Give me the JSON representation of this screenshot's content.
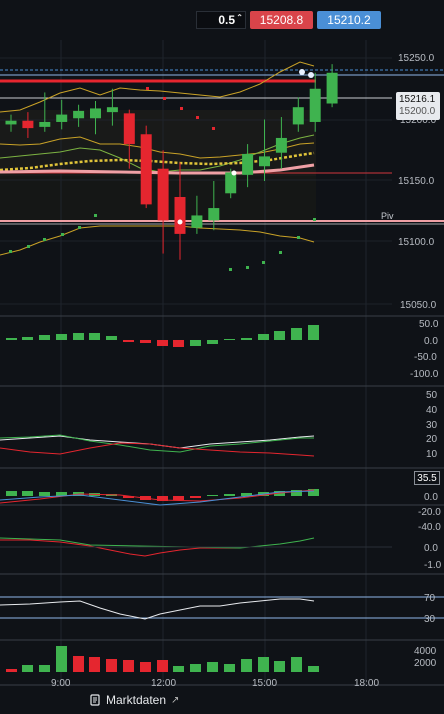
{
  "toolbar": {
    "quantity": "0.5",
    "sell_price": "15208.8",
    "buy_price": "15210.2"
  },
  "price_axis": {
    "ticks": [
      "15250.0",
      "15200.0",
      "15150.0",
      "15100.0",
      "15050.0"
    ],
    "last_price": "15216.1",
    "last_price_sub": "15200.0",
    "pivot_label": "Piv"
  },
  "time_axis": {
    "ticks": [
      "9:00",
      "12:00",
      "15:00",
      "18:00"
    ]
  },
  "panels": {
    "p1_ticks": [
      "50.0",
      "0.0",
      "-50.0",
      "-100.0"
    ],
    "p2_ticks": [
      "50",
      "40",
      "30",
      "20",
      "10"
    ],
    "p3_ticks": [
      "0.0",
      "-20.0",
      "-40.0"
    ],
    "p3_current": "35.5",
    "p4_ticks": [
      "0.0",
      "-1.0"
    ],
    "p5_ticks": [
      "70",
      "30"
    ],
    "p6_ticks": [
      "4000",
      "2000"
    ]
  },
  "footer": {
    "market_data_label": "Marktdaten"
  },
  "colors": {
    "up": "#3fb34f",
    "down": "#e5262f",
    "sell": "#d9444a",
    "buy": "#4a8fd6",
    "envelope": "#c9a227",
    "ma": "#e0c43a",
    "pivot": "#f0a0a5"
  },
  "chart_data": {
    "type": "candlestick",
    "ylim": [
      15035,
      15265
    ],
    "candles": [
      {
        "o": 15196,
        "h": 15204,
        "l": 15190,
        "c": 15199
      },
      {
        "o": 15199,
        "h": 15206,
        "l": 15185,
        "c": 15193
      },
      {
        "o": 15194,
        "h": 15222,
        "l": 15190,
        "c": 15198
      },
      {
        "o": 15198,
        "h": 15216,
        "l": 15192,
        "c": 15204
      },
      {
        "o": 15201,
        "h": 15212,
        "l": 15194,
        "c": 15207
      },
      {
        "o": 15201,
        "h": 15215,
        "l": 15188,
        "c": 15209
      },
      {
        "o": 15206,
        "h": 15225,
        "l": 15195,
        "c": 15210
      },
      {
        "o": 15205,
        "h": 15208,
        "l": 15160,
        "c": 15180
      },
      {
        "o": 15188,
        "h": 15195,
        "l": 15128,
        "c": 15131
      },
      {
        "o": 15160,
        "h": 15175,
        "l": 15091,
        "c": 15118
      },
      {
        "o": 15137,
        "h": 15165,
        "l": 15086,
        "c": 15107
      },
      {
        "o": 15112,
        "h": 15138,
        "l": 15107,
        "c": 15122
      },
      {
        "o": 15118,
        "h": 15150,
        "l": 15110,
        "c": 15128
      },
      {
        "o": 15140,
        "h": 15160,
        "l": 15136,
        "c": 15157
      },
      {
        "o": 15155,
        "h": 15180,
        "l": 15145,
        "c": 15172
      },
      {
        "o": 15162,
        "h": 15200,
        "l": 15150,
        "c": 15170
      },
      {
        "o": 15173,
        "h": 15202,
        "l": 15160,
        "c": 15185
      },
      {
        "o": 15196,
        "h": 15218,
        "l": 15190,
        "c": 15210
      },
      {
        "o": 15198,
        "h": 15238,
        "l": 15190,
        "c": 15225
      },
      {
        "o": 15213,
        "h": 15245,
        "l": 15210,
        "c": 15238
      }
    ],
    "pivot": 15122,
    "support_line": 15154,
    "resistance_line": 15230
  }
}
